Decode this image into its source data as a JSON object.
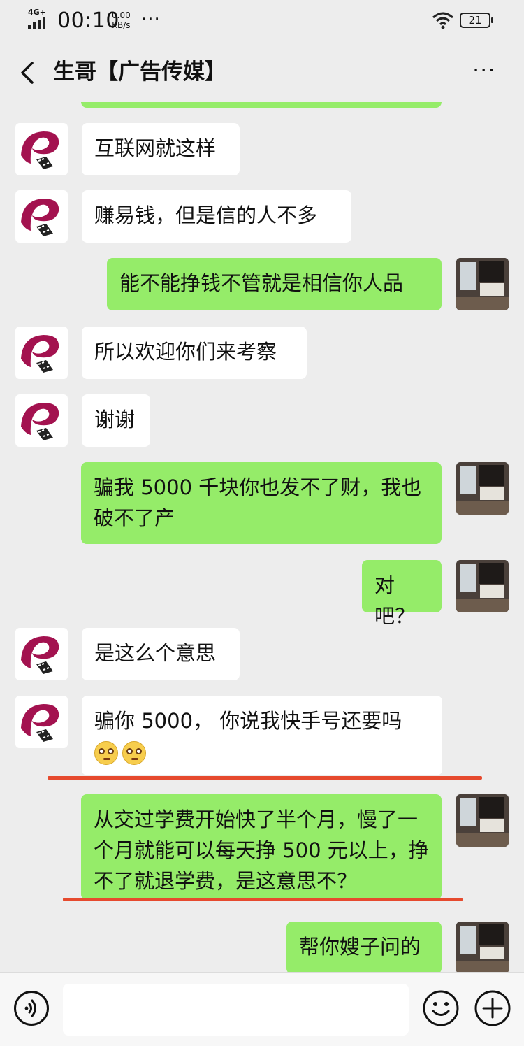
{
  "status_bar": {
    "network": "4G+",
    "time": "00:10",
    "speed_value": "0.00",
    "speed_unit": "KB/s",
    "more_dots": "···",
    "battery": "21"
  },
  "header": {
    "title": "生哥【广告传媒】",
    "more_label": "···"
  },
  "messages": [
    {
      "side": "left",
      "text": "互联网就这样"
    },
    {
      "side": "left",
      "text": "赚易钱，但是信的人不多"
    },
    {
      "side": "right",
      "text": "能不能挣钱不管就是相信你人品"
    },
    {
      "side": "left",
      "text": "所以欢迎你们来考察"
    },
    {
      "side": "left",
      "text": "谢谢"
    },
    {
      "side": "right",
      "text": "骗我 5000 千块你也发不了财，我也破不了产"
    },
    {
      "side": "right",
      "text": "对吧？"
    },
    {
      "side": "left",
      "text": "是这么个意思"
    },
    {
      "side": "left",
      "text": "骗你 5000， 你说我快手号还要吗",
      "emojis": [
        "pleading-face",
        "pleading-face"
      ]
    },
    {
      "side": "right",
      "text": "从交过学费开始快了半个月，慢了一个月就能可以每天挣 500 元以上，挣不了就退学费，是这意思不？"
    },
    {
      "side": "right",
      "text": "帮你嫂子问的"
    }
  ],
  "input": {
    "value": ""
  },
  "icons": {
    "back": "chevron-left-icon",
    "voice": "voice-icon",
    "emoji": "smile-icon",
    "add": "plus-icon"
  },
  "colors": {
    "background": "#ededed",
    "sent_bubble": "#95ec69",
    "received_bubble": "#ffffff",
    "underline": "#e64a2e"
  }
}
